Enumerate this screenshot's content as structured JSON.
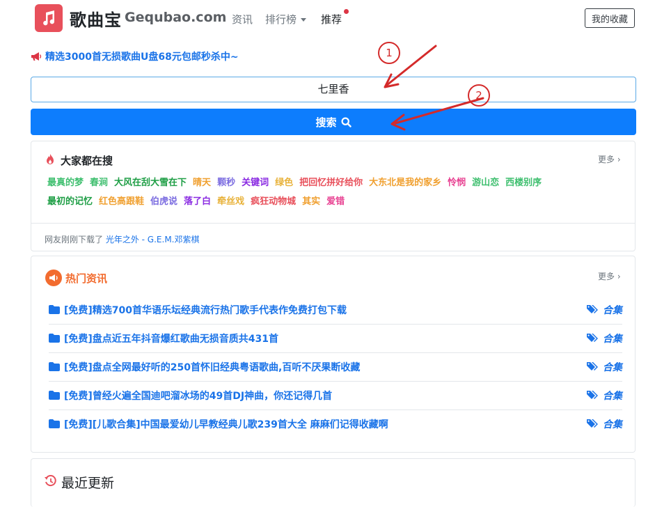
{
  "header": {
    "brand_cn": "歌曲宝",
    "brand_en": "Gequbao.com",
    "nav": [
      "资讯",
      "排行榜",
      "推荐"
    ],
    "favorites_button": "我的收藏"
  },
  "promo": {
    "text": "精选3000首无损歌曲U盘68元包邮秒杀中~"
  },
  "search": {
    "value": "七里香",
    "button_label": "搜索"
  },
  "hot_search": {
    "title": "大家都在搜",
    "more": "更多",
    "tags": [
      {
        "label": "最真的梦",
        "color": "#3fbf6f"
      },
      {
        "label": "春涧",
        "color": "#3fbf6f"
      },
      {
        "label": "大风在刮大雪在下",
        "color": "#1e9e45"
      },
      {
        "label": "晴天",
        "color": "#f0a030"
      },
      {
        "label": "颗秒",
        "color": "#7b6ce0"
      },
      {
        "label": "关键词",
        "color": "#8a2be2"
      },
      {
        "label": "绿色",
        "color": "#e8b23a"
      },
      {
        "label": "把回忆拼好给你",
        "color": "#e8505b"
      },
      {
        "label": "大东北是我的家乡",
        "color": "#f0a030"
      },
      {
        "label": "怜悯",
        "color": "#e84393"
      },
      {
        "label": "游山恋",
        "color": "#3fbf6f"
      },
      {
        "label": "西楼别序",
        "color": "#3fbf6f"
      },
      {
        "label": "最初的记忆",
        "color": "#1e9e45"
      },
      {
        "label": "红色高跟鞋",
        "color": "#f0a030"
      },
      {
        "label": "伯虎说",
        "color": "#7b6ce0"
      },
      {
        "label": "落了白",
        "color": "#8a2be2"
      },
      {
        "label": "牵丝戏",
        "color": "#e8b23a"
      },
      {
        "label": "疯狂动物城",
        "color": "#e8505b"
      },
      {
        "label": "其实",
        "color": "#f0a030"
      },
      {
        "label": "爱错",
        "color": "#e84393"
      }
    ],
    "downloaded_prefix": "网友刚刚下载了",
    "downloaded_song": "光年之外 - G.E.M.邓紫棋"
  },
  "hot_news": {
    "title": "热门资讯",
    "more": "更多",
    "items": [
      {
        "title": "[免费]精选700首华语乐坛经典流行热门歌手代表作免费打包下载",
        "tag": "合集"
      },
      {
        "title": "[免费]盘点近五年抖音爆红歌曲无损音质共431首",
        "tag": "合集"
      },
      {
        "title": "[免费]盘点全网最好听的250首怀旧经典粤语歌曲,百听不厌果断收藏",
        "tag": "合集"
      },
      {
        "title": "[免费]曾经火遍全国迪吧溜冰场的49首DJ神曲，你还记得几首",
        "tag": "合集"
      },
      {
        "title": "[免费][儿歌合集]中国最爱幼儿早教经典儿歌239首大全 麻麻们记得收藏啊",
        "tag": "合集"
      }
    ]
  },
  "recent": {
    "title": "最近更新"
  },
  "annotations": {
    "step1": "1",
    "step2": "2"
  },
  "colors": {
    "primary": "#0d7dfd",
    "link": "#1a73e8",
    "logo": "#e8505b",
    "annotation": "#d42a2a"
  }
}
